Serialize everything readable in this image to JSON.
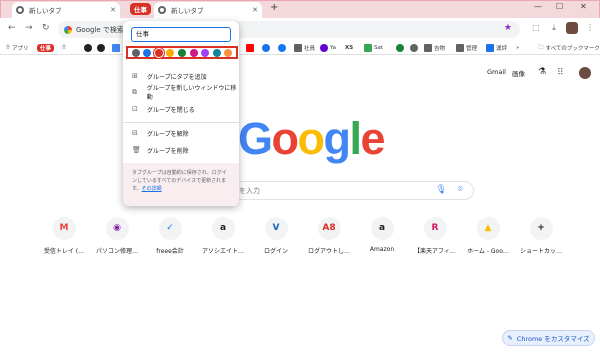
{
  "tabs": [
    {
      "label": "新しいタブ"
    },
    {
      "label": "新しいタブ"
    }
  ],
  "tab_group": {
    "label": "仕事",
    "color": "#d93025"
  },
  "toolbar": {
    "omnibox_text": "Google で検索する",
    "new_tab_glyph": "+"
  },
  "bookmarks": {
    "apps_label": "アプリ",
    "group_label": "仕事",
    "items": [
      "社員",
      "Ya",
      "XS",
      "Sat",
      "吉物",
      "管理",
      "運評"
    ],
    "all_bookmarks": "すべてのブックマーク"
  },
  "google": {
    "top_links": [
      "Gmail",
      "画像"
    ],
    "logo_letters": [
      "G",
      "o",
      "o",
      "g",
      "l",
      "e"
    ],
    "logo_colors": [
      "#4285f4",
      "#ea4335",
      "#fbbc05",
      "#4285f4",
      "#34a853",
      "#ea4335"
    ],
    "search_placeholder": "を入力",
    "customize_label": "Chrome をカスタマイズ"
  },
  "shortcuts": [
    {
      "label": "受信トレイ (…",
      "glyph": "M",
      "color": "#ea4335"
    },
    {
      "label": "パソコン修理…",
      "glyph": "◉",
      "color": "#8e24aa"
    },
    {
      "label": "freee会計",
      "glyph": "✓",
      "color": "#1a73e8"
    },
    {
      "label": "アソシエイト…",
      "glyph": "a",
      "color": "#202124"
    },
    {
      "label": "ログイン",
      "glyph": "V",
      "color": "#1565c0"
    },
    {
      "label": "ログアウトし…",
      "glyph": "A8",
      "color": "#d93025"
    },
    {
      "label": "Amazon",
      "glyph": "a",
      "color": "#202124"
    },
    {
      "label": "【楽天アフィ…",
      "glyph": "R",
      "color": "#d81b60"
    },
    {
      "label": "ホーム - Goo…",
      "glyph": "▲",
      "color": "#fbbc05"
    },
    {
      "label": "ショートカッ…",
      "glyph": "+",
      "color": "#202124"
    }
  ],
  "group_editor": {
    "name_value": "仕事",
    "colors": [
      "#5f6368",
      "#1a73e8",
      "#d93025",
      "#f9ab00",
      "#188038",
      "#d01884",
      "#a142f4",
      "#12849c",
      "#fa903e"
    ],
    "selected_color_index": 2,
    "menu": [
      {
        "label": "グループにタブを追加",
        "icon": "add-tab-icon"
      },
      {
        "label": "グループを新しいウィンドウに移動",
        "icon": "move-window-icon"
      },
      {
        "label": "グループを閉じる",
        "icon": "close-group-icon"
      },
      {
        "label": "グループを解除",
        "icon": "ungroup-icon"
      },
      {
        "label": "グループを削除",
        "icon": "delete-icon"
      }
    ],
    "footnote": "タブグループは自動的に保存され、ログインしているすべてのデバイスで更新されます。",
    "footnote_link": "その詳細"
  }
}
